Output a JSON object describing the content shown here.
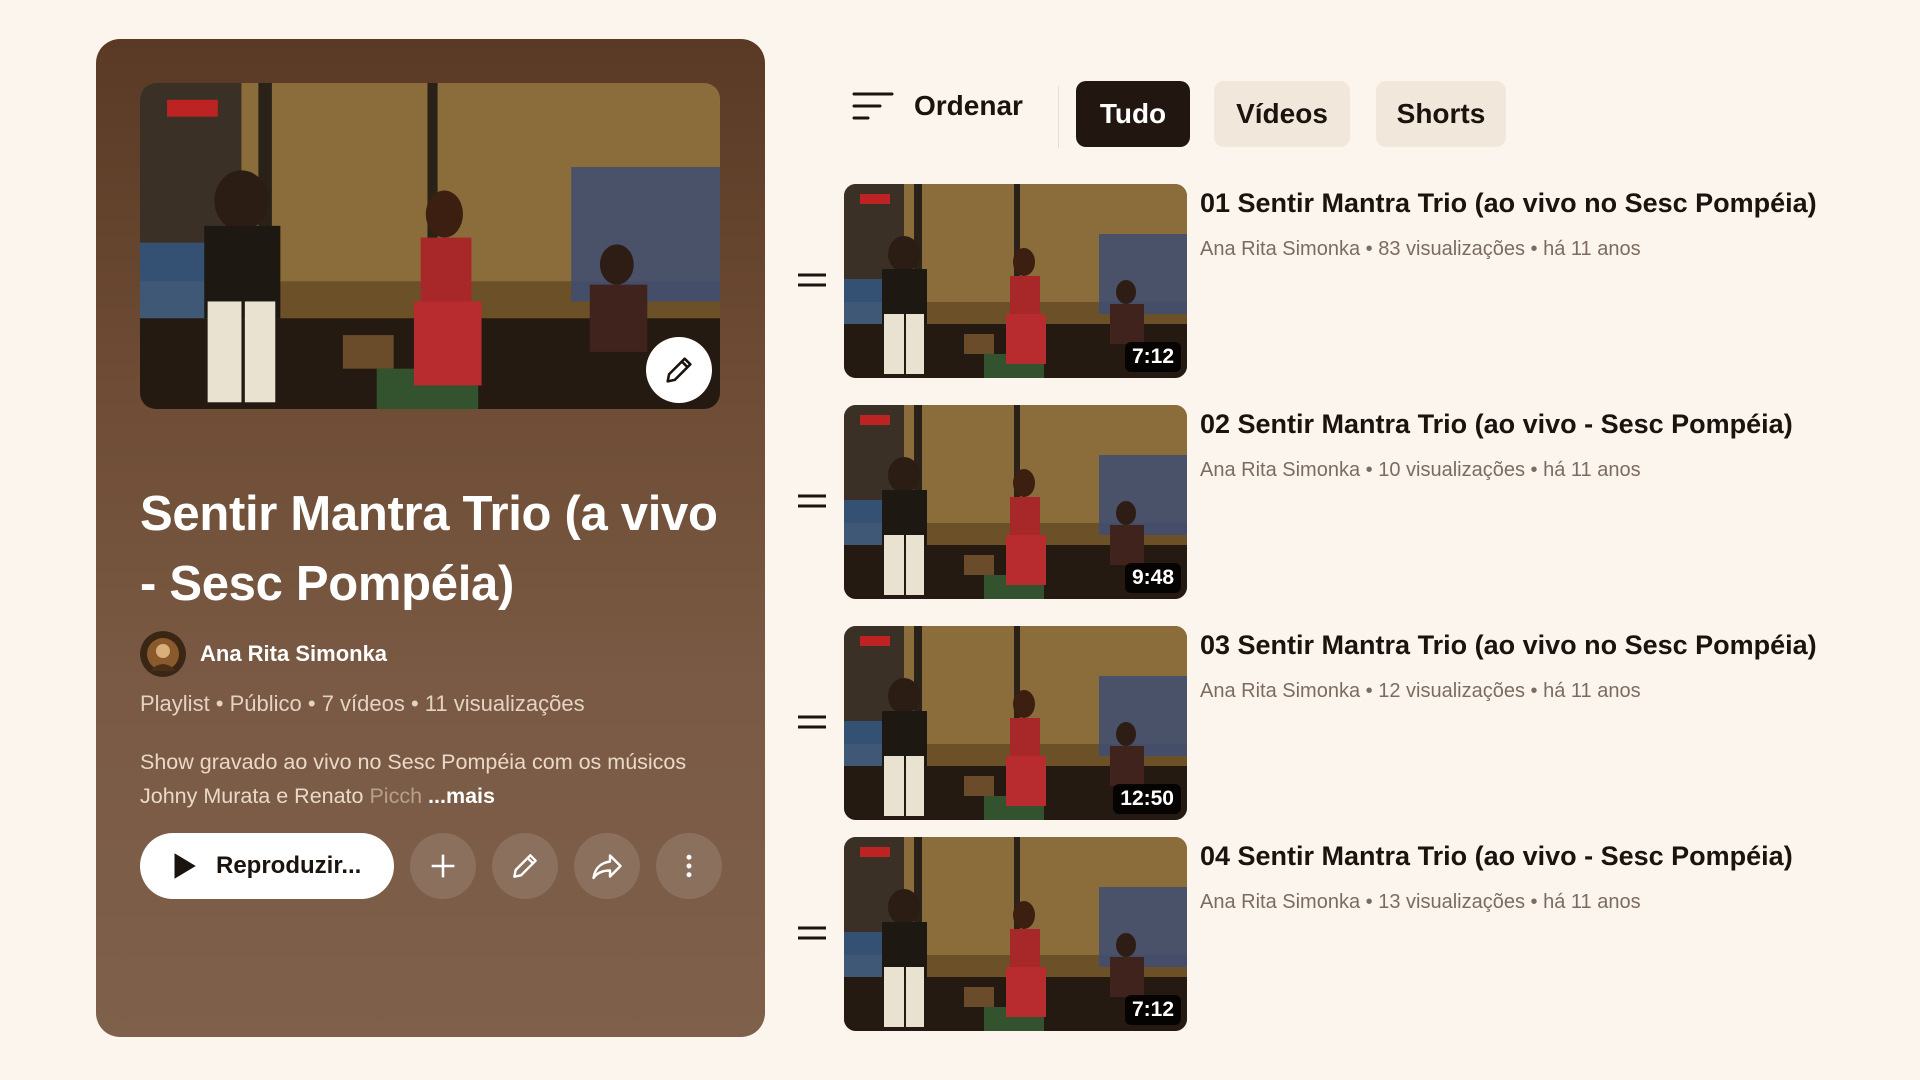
{
  "playlist": {
    "title": "Sentir Mantra Trio (a vivo - Sesc Pompéia)",
    "channel_name": "Ana Rita Simonka",
    "meta": "Playlist • Público • 7 vídeos • 11 visualizações",
    "description_visible": "Show gravado ao vivo no Sesc Pompéia com os músicos Johny Murata e Renato ",
    "description_faded": "Picch",
    "description_more": "...mais",
    "play_label": "Reproduzir...",
    "colors": {
      "panel_top": "#5a3a25",
      "panel_bottom": "#7e604b",
      "page_bg": "#fbf5ee"
    }
  },
  "filters": {
    "sort_label": "Ordenar",
    "chips": [
      {
        "label": "Tudo",
        "selected": true
      },
      {
        "label": "Vídeos",
        "selected": false
      },
      {
        "label": "Shorts",
        "selected": false
      }
    ]
  },
  "videos": [
    {
      "title": "01 Sentir Mantra Trio (ao vivo no Sesc Pompéia)",
      "channel": "Ana Rita Simonka",
      "views": "83 visualizações",
      "age": "há 11 anos",
      "duration": "7:12"
    },
    {
      "title": "02 Sentir Mantra Trio (ao vivo - Sesc Pompéia)",
      "channel": "Ana Rita Simonka",
      "views": "10 visualizações",
      "age": "há 11 anos",
      "duration": "9:48"
    },
    {
      "title": "03 Sentir Mantra Trio (ao vivo no Sesc Pompéia)",
      "channel": "Ana Rita Simonka",
      "views": "12 visualizações",
      "age": "há 11 anos",
      "duration": "12:50"
    },
    {
      "title": "04 Sentir Mantra Trio (ao vivo - Sesc Pompéia)",
      "channel": "Ana Rita Simonka",
      "views": "13 visualizações",
      "age": "há 11 anos",
      "duration": "7:12"
    }
  ],
  "icons": {
    "sort": "sort-lines-icon",
    "edit": "pencil-icon",
    "add": "plus-icon",
    "share": "share-arrow-icon",
    "more": "vertical-dots-icon",
    "play": "play-triangle-icon",
    "drag": "drag-handle-icon"
  }
}
